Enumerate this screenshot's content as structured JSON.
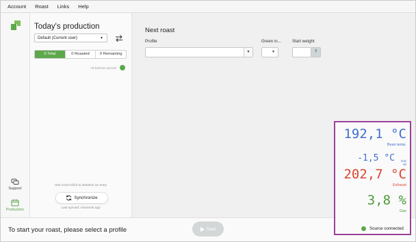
{
  "menu": [
    "Account",
    "Roast",
    "Links",
    "Help"
  ],
  "rail": {
    "support_label": "Support",
    "production_label": "Production"
  },
  "panel": {
    "title": "Today's production",
    "user_select": "Default (Current user)",
    "tabs": [
      "0 Total",
      "0 Roasted",
      "0 Remaining"
    ],
    "synced_note": "All batches synced",
    "hint": "Use Cmd+Click to deselect an entry",
    "sync_button": "Synchronize",
    "last_synced": "Last synced: moments ago"
  },
  "main": {
    "title": "Next roast",
    "profile_label": "Profile",
    "green_label": "Green in...",
    "weight_label": "Start weight",
    "weight_help": "?"
  },
  "bottom": {
    "status": "To start your roast, please select a profile",
    "start_button": "Start"
  },
  "readout": {
    "bean_temp": "192,1 °C",
    "bean_label": "Bean temp.",
    "ror": "-1,5 °C",
    "ror_unit_top": "/min",
    "ror_unit_bottom": "60",
    "exhaust_temp": "202,7 °C",
    "exhaust_label": "Exhaust",
    "gas": "3,8 %",
    "gas_label": "Gas",
    "source": "Source connected"
  },
  "colors": {
    "accent_green": "#5da84b",
    "bean_blue": "#3f6ed1",
    "exhaust_red": "#d8452f",
    "gas_green": "#4e9a3a",
    "highlight_purple": "#9b3f98"
  }
}
